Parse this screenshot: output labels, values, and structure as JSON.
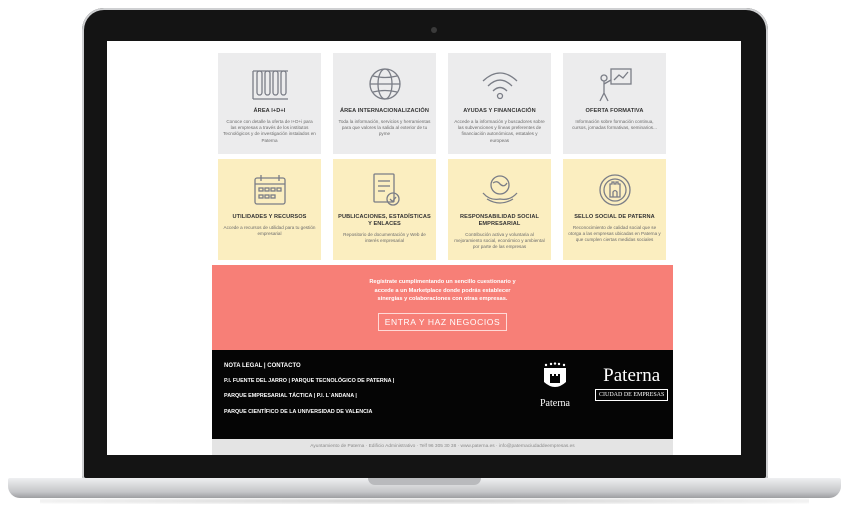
{
  "tiles": [
    {
      "title": "ÁREA I+D+I",
      "desc": "Conoce con detalle la oferta de I+D+i para las empresas a través de los institutos Tecnológicos y de investigación instalados en Paterna",
      "icon": "test-tubes-icon"
    },
    {
      "title": "ÁREA INTERNACIONALIZACIÓN",
      "desc": "Toda la información, servicios y herramientas para que valores la salida al exterior de tu pyme",
      "icon": "globe-icon"
    },
    {
      "title": "AYUDAS Y FINANCIACIÓN",
      "desc": "Accede a la información y buscadores sobre las subvenciones y líneas preferentes de financiación autonómicas, estatales y europeas",
      "icon": "wifi-signal-icon"
    },
    {
      "title": "OFERTA FORMATIVA",
      "desc": "Información sobre formación continua, cursos, jornadas formativas, seminarios...",
      "icon": "presentation-icon"
    },
    {
      "title": "UTILIDADES Y RECURSOS",
      "desc": "Accede a recursos de utilidad para tu gestión empresarial",
      "icon": "calendar-icon"
    },
    {
      "title": "PUBLICACIONES, ESTADÍSTICAS Y ENLACES",
      "desc": "Repositorio de documentación y Web de interés empresarial",
      "icon": "document-check-icon"
    },
    {
      "title": "RESPONSABILIDAD SOCIAL EMPRESARIAL",
      "desc": "Contribución activa y voluntaria al mejoramiento social, económico y ambiental por parte de las empresas",
      "icon": "hands-globe-icon"
    },
    {
      "title": "SELLO SOCIAL DE PATERNA",
      "desc": "Reconocimiento de calidad social que se otorga a las empresas ubicadas en Paterna y que cumplen ciertas medidas sociales",
      "icon": "seal-tower-icon"
    }
  ],
  "banner": {
    "message": "Regístrate cumplimentando un sencillo cuestionario y accede a un Marketplace donde podrás establecer sinergias y colaboraciones con otras empresas.",
    "cta": "ENTRA Y HAZ NEGOCIOS"
  },
  "footer": {
    "legal": "NOTA LEGAL | CONTACTO",
    "line1": "P.I. FUENTE DEL JARRO | PARQUE TECNOLÓGICO DE PATERNA |",
    "line2": "PARQUE EMPRESARIAL TÁCTICA | P.I. L´ANDANA |",
    "line3": "PARQUE CIENTÍFICO DE LA UNIVERSIDAD DE VALENCIA",
    "crest_word": "Paterna",
    "brand_name": "Paterna",
    "brand_tag": "CIUDAD DE EMPRESAS"
  },
  "address": "Ayuntamiento de Paterna · Edificio Administrativo · Telf 96 305 30 38 · www.paterna.es · info@paternaciudaddeempresas.es",
  "colors": {
    "tile_gray": "#ececed",
    "tile_yellow": "#fbeec0",
    "banner": "#f77f77",
    "footer": "#050505"
  }
}
